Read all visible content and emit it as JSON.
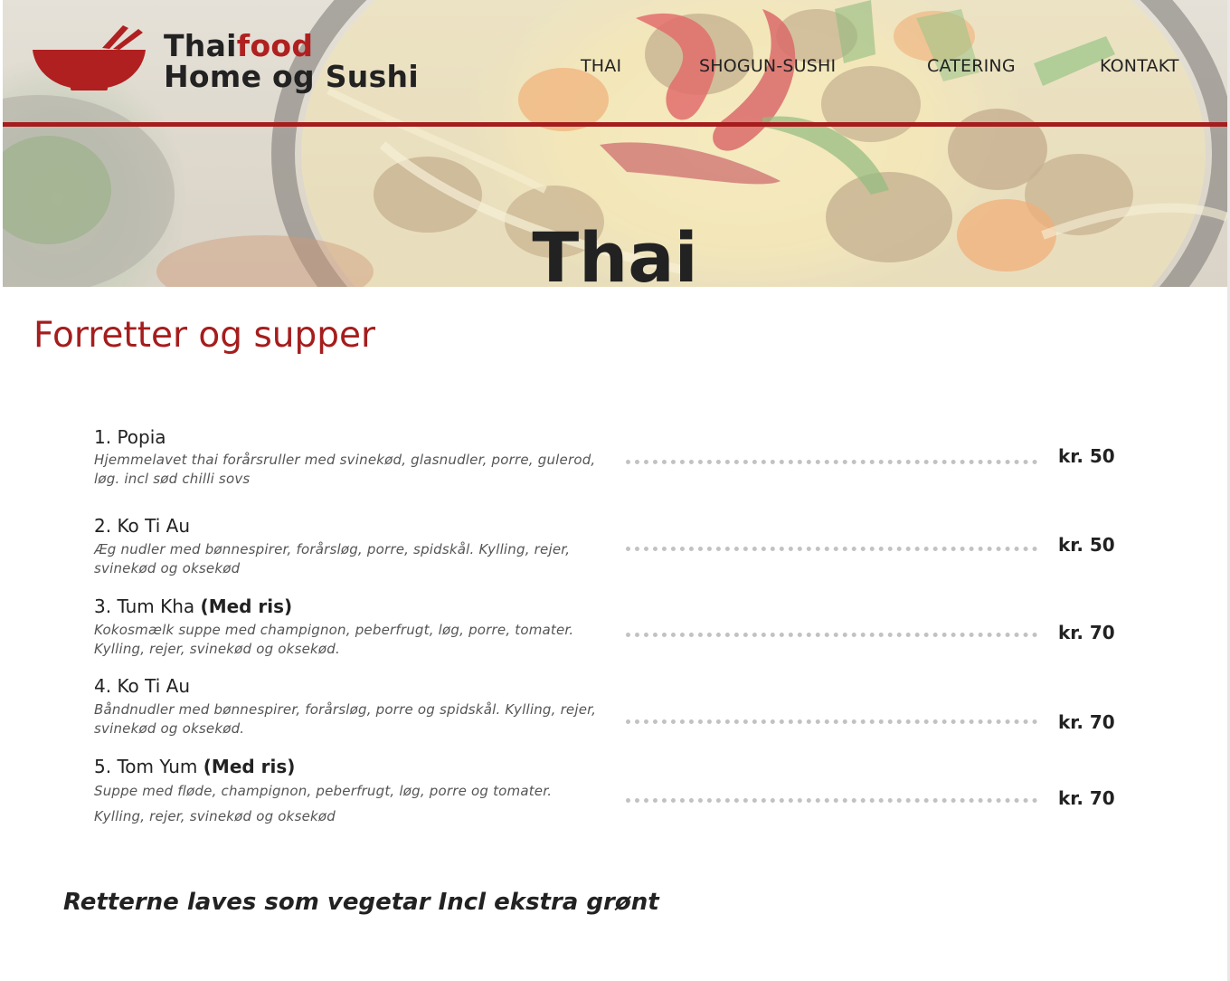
{
  "colors": {
    "accent": "#a51d1d",
    "text": "#222222",
    "muted": "#555555",
    "dots": "#c2c2c2"
  },
  "header": {
    "logo_icon": "bowl-with-chopsticks-icon",
    "brand_part1": "Thai",
    "brand_part2": "food",
    "brand_line2": "Home og Sushi",
    "nav": [
      "THAI",
      "SHOGUN-SUSHI",
      "CATERING",
      "KONTAKT"
    ]
  },
  "hero": {
    "title": "Thai"
  },
  "menu": {
    "heading": "Forretter og supper",
    "items": [
      {
        "name": "1. Popia",
        "note": "",
        "description": "Hjemmelavet thai forårsruller med svinekød, glasnudler, porre, gulerod, løg. incl sød chilli sovs",
        "price": "kr. 50"
      },
      {
        "name": "2. Ko Ti Au",
        "note": "",
        "description": "Æg nudler med bønnespirer, forårsløg, porre, spidskål. Kylling, rejer, svinekød og oksekød",
        "price": "kr. 50"
      },
      {
        "name": "3. Tum Kha ",
        "note": "(Med ris)",
        "description": "Kokosmælk suppe med champignon, peberfrugt, løg, porre, tomater. Kylling, rejer, svinekød og oksekød.",
        "price": "kr. 70"
      },
      {
        "name": "4. Ko Ti Au",
        "note": "",
        "description": "Båndnudler med bønnespirer, forårsløg, porre og spidskål. Kylling, rejer, svinekød og oksekød.",
        "price": "kr. 70"
      },
      {
        "name": "5. Tom Yum ",
        "note": "(Med ris)",
        "description_line1": "Suppe med fløde, champignon, peberfrugt, løg, porre og tomater.",
        "description_line2": "Kylling, rejer, svinekød og oksekød",
        "price": "kr. 70"
      }
    ],
    "footer_note": "Retterne laves som vegetar Incl ekstra grønt"
  }
}
